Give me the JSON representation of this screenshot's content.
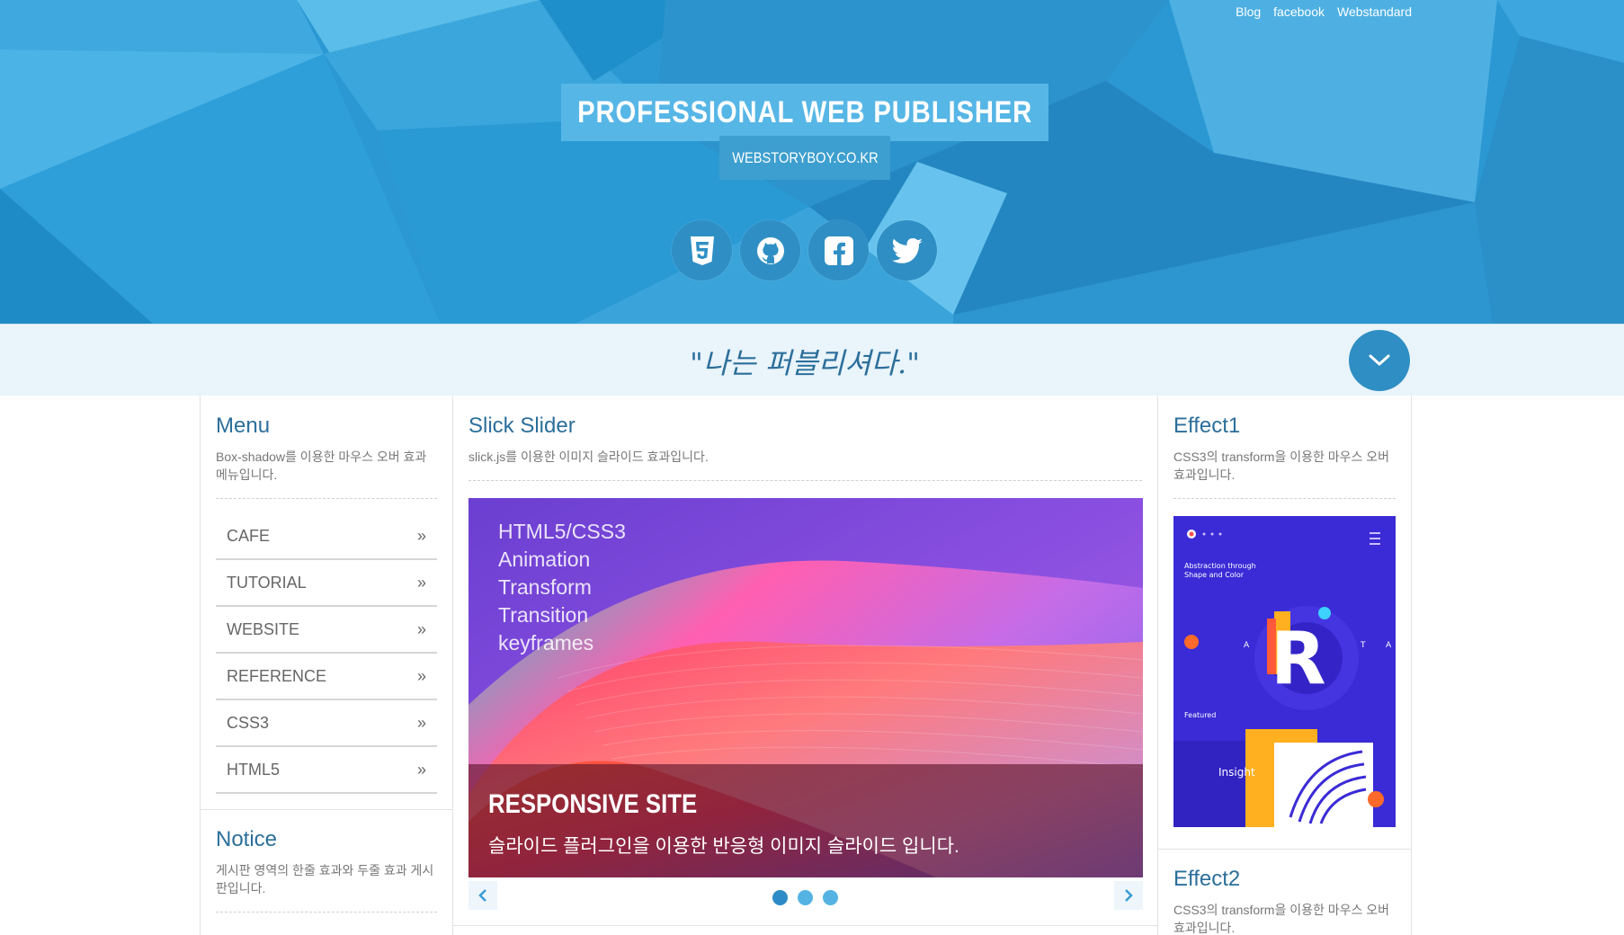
{
  "top_nav": {
    "blog": "Blog",
    "facebook": "facebook",
    "webstandard": "Webstandard"
  },
  "header": {
    "title": "PROFESSIONAL WEB PUBLISHER",
    "subtitle": "WEBSTORYBOY.CO.KR"
  },
  "social_icons": [
    "html5-icon",
    "github-icon",
    "facebook-icon",
    "twitter-icon"
  ],
  "quote": "\"나는 퍼블리셔다.\"",
  "menu": {
    "title": "Menu",
    "desc": "Box-shadow를 이용한 마우스 오버 효과 메뉴입니다.",
    "items": [
      {
        "label": "CAFE",
        "arrow": "»"
      },
      {
        "label": "TUTORIAL",
        "arrow": "»"
      },
      {
        "label": "WEBSITE",
        "arrow": "»"
      },
      {
        "label": "REFERENCE",
        "arrow": "»"
      },
      {
        "label": "CSS3",
        "arrow": "»"
      },
      {
        "label": "HTML5",
        "arrow": "»"
      }
    ]
  },
  "notice": {
    "title": "Notice",
    "desc": "게시판 영역의 한줄 효과와 두줄 효과 게시판입니다."
  },
  "slider": {
    "title": "Slick Slider",
    "desc": "slick.js를 이용한 이미지 슬라이드 효과입니다.",
    "overlay_lines": [
      "HTML5/CSS3",
      "Animation",
      "Transform",
      "Transition",
      "keyframes"
    ],
    "caption_title": "RESPONSIVE SITE",
    "caption_text": "슬라이드 플러그인을 이용한 반응형 이미지 슬라이드 입니다.",
    "dots": 3,
    "active_dot": 1
  },
  "effect1": {
    "title": "Effect1",
    "desc": "CSS3의 transform을 이용한 마우스 오버효과입니다.",
    "image": {
      "headline": "Abstraction through Shape and Color",
      "featured": "Featured",
      "insight": "Insight",
      "letter": "R",
      "side_a": "A",
      "side_t": "T"
    }
  },
  "effect2": {
    "title": "Effect2",
    "desc": "CSS3의 transform을 이용한 마우스 오버효과입니다."
  },
  "colors": {
    "header_blue": "#2a97d2",
    "accent": "#2c6f9b",
    "button": "#2f8ec3"
  }
}
